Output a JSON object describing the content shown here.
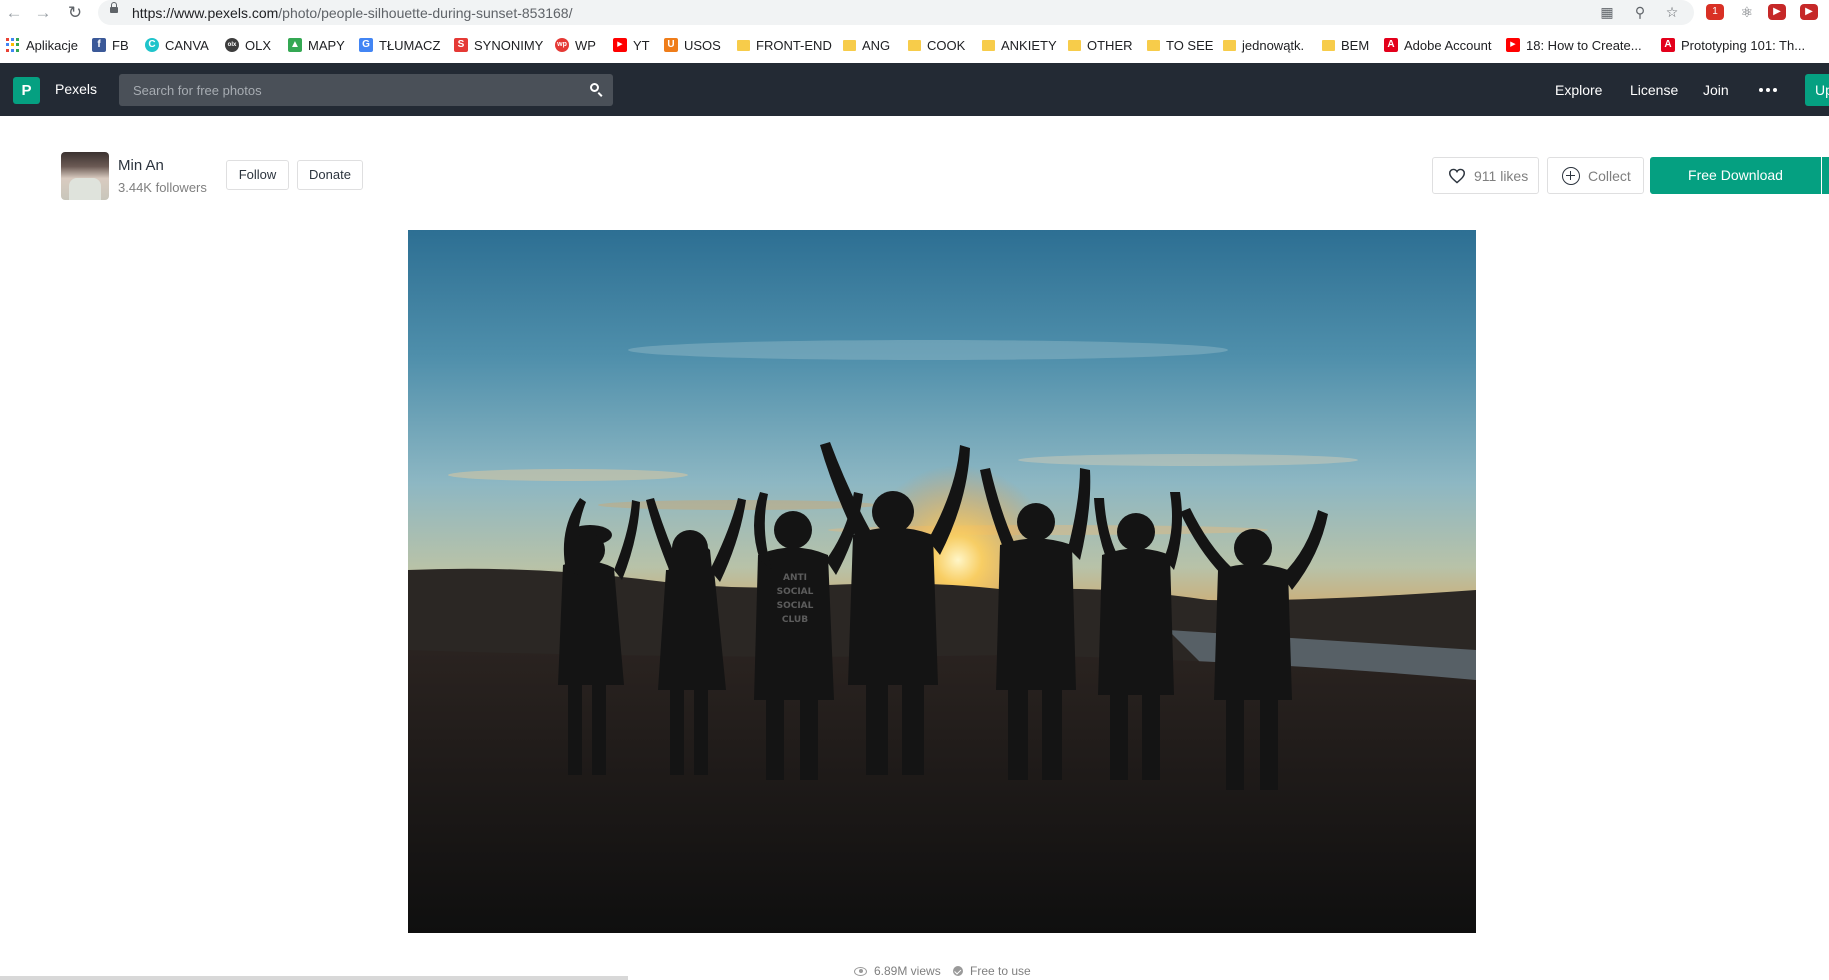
{
  "browser": {
    "url_host": "https://www.pexels.com",
    "url_path": "/photo/people-silhouette-during-sunset-853168/",
    "bookmarks": [
      {
        "label": "Aplikacje",
        "icon": "apps-grid-icon"
      },
      {
        "label": "FB",
        "icon": "facebook-icon",
        "color": "#3b5998"
      },
      {
        "label": "CANVA",
        "icon": "canva-icon",
        "color": "#20c4cb"
      },
      {
        "label": "OLX",
        "icon": "olx-icon",
        "color": "#3d3d3d"
      },
      {
        "label": "MAPY",
        "icon": "google-maps-icon",
        "color": "#34a853"
      },
      {
        "label": "TŁUMACZ",
        "icon": "google-translate-icon",
        "color": "#4285f4"
      },
      {
        "label": "SYNONIMY",
        "icon": "s-icon",
        "color": "#e53935"
      },
      {
        "label": "WP",
        "icon": "wp-icon",
        "color": "#e53935"
      },
      {
        "label": "YT",
        "icon": "youtube-icon",
        "color": "#ff0000"
      },
      {
        "label": "USOS",
        "icon": "u-icon",
        "color": "#ef7d1a"
      },
      {
        "label": "FRONT-END",
        "icon": "folder-icon"
      },
      {
        "label": "ANG",
        "icon": "folder-icon"
      },
      {
        "label": "COOK",
        "icon": "folder-icon"
      },
      {
        "label": "ANKIETY",
        "icon": "folder-icon"
      },
      {
        "label": "OTHER",
        "icon": "folder-icon"
      },
      {
        "label": "TO SEE",
        "icon": "folder-icon"
      },
      {
        "label": "jednowątk.",
        "icon": "folder-icon"
      },
      {
        "label": "BEM",
        "icon": "folder-icon"
      },
      {
        "label": "Adobe Account",
        "icon": "adobe-icon",
        "color": "#e3001b"
      },
      {
        "label": "18: How to Create...",
        "icon": "youtube-icon",
        "color": "#ff0000"
      },
      {
        "label": "Prototyping 101: Th...",
        "icon": "adobe-icon",
        "color": "#e3001b"
      }
    ]
  },
  "header": {
    "brand": "Pexels",
    "search_placeholder": "Search for free photos",
    "nav": [
      "Explore",
      "License",
      "Join"
    ],
    "upload_label": "Up"
  },
  "author": {
    "name": "Min An",
    "followers": "3.44K followers",
    "follow_label": "Follow",
    "donate_label": "Donate"
  },
  "actions": {
    "likes": "911 likes",
    "collect": "Collect",
    "download": "Free Download"
  },
  "stats": {
    "views": "6.89M views",
    "license": "Free to use"
  },
  "colors": {
    "brand": "#05a081",
    "header_bg": "#232a34"
  }
}
